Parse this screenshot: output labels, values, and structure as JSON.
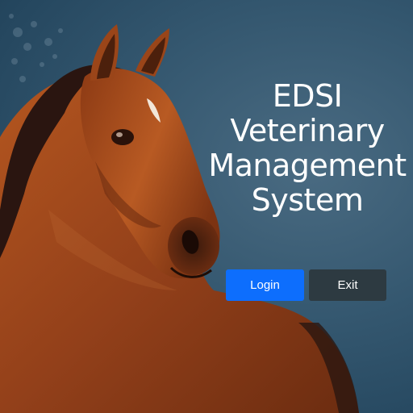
{
  "title": {
    "line1": "EDSI",
    "line2": "Veterinary",
    "line3": "Management",
    "line4": "System"
  },
  "buttons": {
    "login_label": "Login",
    "exit_label": "Exit"
  },
  "colors": {
    "login_button": "#0d6efd",
    "exit_button": "#2d3a41",
    "background": "#2f5068",
    "horse_coat": "#9a4417"
  }
}
